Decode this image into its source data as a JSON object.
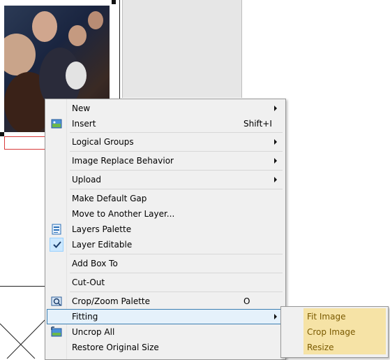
{
  "menu": {
    "items": [
      {
        "label": "New",
        "submenu": true
      },
      {
        "label": "Insert",
        "shortcut": "Shift+I",
        "icon": "image-icon"
      },
      {
        "label": "Logical Groups",
        "submenu": true
      },
      {
        "label": "Image Replace Behavior",
        "submenu": true
      },
      {
        "label": "Upload",
        "submenu": true
      },
      {
        "label": "Make Default Gap"
      },
      {
        "label": "Move to Another Layer..."
      },
      {
        "label": "Layers Palette",
        "icon": "layers-palette-icon"
      },
      {
        "label": "Layer Editable",
        "checked": true,
        "icon": "checkmark-icon"
      },
      {
        "label": "Add Box To"
      },
      {
        "label": "Cut-Out"
      },
      {
        "label": "Crop/Zoom Palette",
        "shortcut": "O",
        "icon": "crop-zoom-icon"
      },
      {
        "label": "Fitting",
        "submenu": true,
        "highlighted": true
      },
      {
        "label": "Uncrop All",
        "icon": "uncrop-icon"
      },
      {
        "label": "Restore Original Size"
      }
    ]
  },
  "submenu": {
    "items": [
      "Fit Image",
      "Crop Image",
      "Resize"
    ]
  },
  "colors": {
    "menu_bg": "#f0f0f0",
    "highlight_bg": "#e5f1fb",
    "highlight_border": "#3c7fb1",
    "submenu_highlight": "#f6e3a6",
    "selection_border": "#d83a3a"
  }
}
